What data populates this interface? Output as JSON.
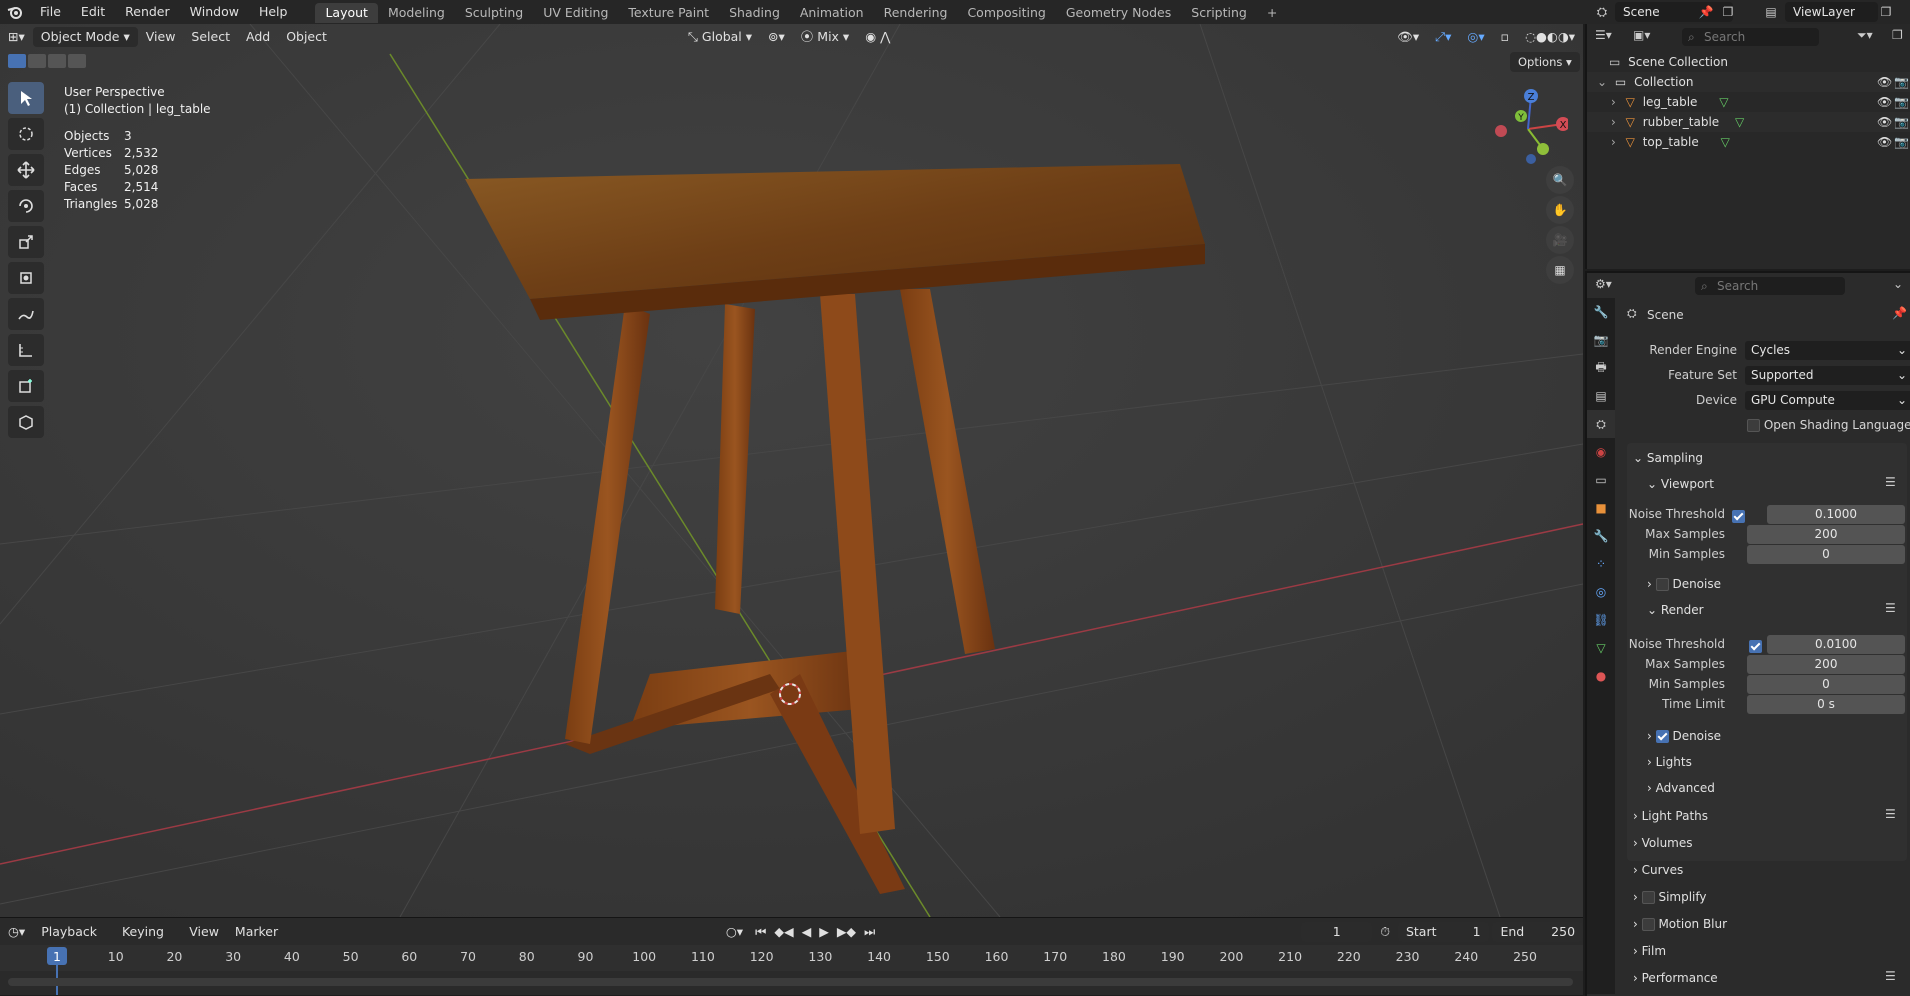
{
  "topbar": {
    "menus": [
      "File",
      "Edit",
      "Render",
      "Window",
      "Help"
    ],
    "workspaces": [
      "Layout",
      "Modeling",
      "Sculpting",
      "UV Editing",
      "Texture Paint",
      "Shading",
      "Animation",
      "Rendering",
      "Compositing",
      "Geometry Nodes",
      "Scripting"
    ],
    "active_workspace": "Layout",
    "add_tab": "+",
    "scene_name": "Scene",
    "view_layer": "ViewLayer"
  },
  "viewport": {
    "mode": "Object Mode",
    "menus": [
      "View",
      "Select",
      "Add",
      "Object"
    ],
    "orientation": "Global",
    "pivot": "Mix",
    "options": "Options",
    "perspective": "User Perspective",
    "collection_info": "(1) Collection | leg_table",
    "stats": [
      {
        "label": "Objects",
        "value": "3"
      },
      {
        "label": "Vertices",
        "value": "2,532"
      },
      {
        "label": "Edges",
        "value": "5,028"
      },
      {
        "label": "Faces",
        "value": "2,514"
      },
      {
        "label": "Triangles",
        "value": "5,028"
      }
    ],
    "gizmo": {
      "x": "X",
      "y": "Y",
      "z": "Z"
    }
  },
  "outliner": {
    "search_placeholder": "Search",
    "root": "Scene Collection",
    "collection": "Collection",
    "objects": [
      "leg_table",
      "rubber_table",
      "top_table"
    ]
  },
  "properties": {
    "search_placeholder": "Search",
    "context": "Scene",
    "render_engine_label": "Render Engine",
    "render_engine": "Cycles",
    "feature_set_label": "Feature Set",
    "feature_set": "Supported",
    "device_label": "Device",
    "device": "GPU Compute",
    "osl_label": "Open Shading Language",
    "sampling": "Sampling",
    "viewport_section": "Viewport",
    "vp_noise_label": "Noise Threshold",
    "vp_noise": "0.1000",
    "vp_max_label": "Max Samples",
    "vp_max": "200",
    "vp_min_label": "Min Samples",
    "vp_min": "0",
    "vp_denoise": "Denoise",
    "render_section": "Render",
    "r_noise_label": "Noise Threshold",
    "r_noise": "0.0100",
    "r_max_label": "Max Samples",
    "r_max": "200",
    "r_min_label": "Min Samples",
    "r_min": "0",
    "r_time_label": "Time Limit",
    "r_time": "0 s",
    "r_denoise": "Denoise",
    "lights": "Lights",
    "advanced": "Advanced",
    "panels": [
      "Light Paths",
      "Volumes",
      "Curves",
      "Simplify",
      "Motion Blur",
      "Film",
      "Performance"
    ]
  },
  "timeline": {
    "menus": [
      "Playback",
      "Keying",
      "View",
      "Marker"
    ],
    "current_frame": "1",
    "start_label": "Start",
    "start": "1",
    "end_label": "End",
    "end": "250",
    "ticks": [
      "1",
      "10",
      "20",
      "30",
      "40",
      "50",
      "60",
      "70",
      "80",
      "90",
      "100",
      "110",
      "120",
      "130",
      "140",
      "150",
      "160",
      "170",
      "180",
      "190",
      "200",
      "210",
      "220",
      "230",
      "240",
      "250"
    ]
  }
}
